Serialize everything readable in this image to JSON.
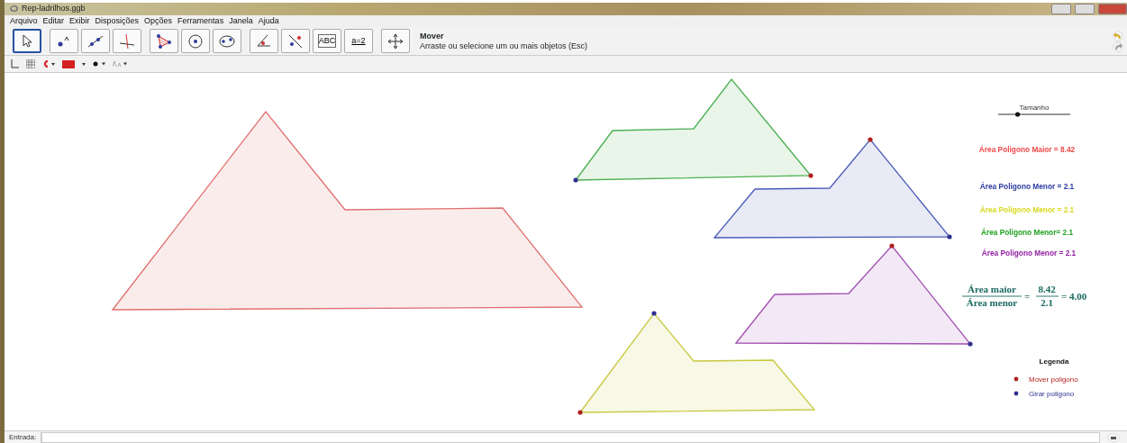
{
  "window": {
    "title": "Rep-ladrilhos.ggb"
  },
  "menu": [
    "Arquivo",
    "Editar",
    "Exibir",
    "Disposições",
    "Opções",
    "Ferramentas",
    "Janela",
    "Ajuda"
  ],
  "tools": [
    {
      "kind": "pointer",
      "selected": true
    },
    {
      "kind": "point",
      "selected": false
    },
    {
      "kind": "line",
      "selected": false
    },
    {
      "kind": "perpendicular",
      "selected": false
    },
    {
      "kind": "polygon",
      "selected": false
    },
    {
      "kind": "circle",
      "selected": false
    },
    {
      "kind": "ellipse",
      "selected": false
    },
    {
      "kind": "angle",
      "selected": false
    },
    {
      "kind": "reflect",
      "selected": false
    },
    {
      "kind": "text",
      "label": "ABC",
      "selected": false
    },
    {
      "kind": "slider",
      "label": "a=2",
      "selected": false
    },
    {
      "kind": "move",
      "selected": false
    }
  ],
  "tool_help": {
    "name": "Mover",
    "hint": "Arraste ou selecione um ou mais objetos (Esc)"
  },
  "style_bar": {
    "color": "#d42020"
  },
  "polygons": [
    {
      "color": "#e07070"
    },
    {
      "color": "#4caf50"
    },
    {
      "color": "#4a5ab8"
    },
    {
      "color": "#a050b0"
    },
    {
      "color": "#c8c840"
    }
  ],
  "slider": {
    "label": "Tamanho",
    "level": 0.27
  },
  "area_labels": [
    {
      "text": "Área Poligono Maior = 8.42",
      "color": "#f04a4a"
    },
    {
      "text": "Área Poligono Menor = 2.1",
      "color": "#2a3aa0"
    },
    {
      "text": "Área Poligono Menor = 2.1",
      "color": "#d8d820"
    },
    {
      "text": "Área Poligono Menor= 2.1",
      "color": "#20a020"
    },
    {
      "text": "Área Poligono Menor = 2.1",
      "color": "#9020a0"
    }
  ],
  "ratio": {
    "num1": "Área maior",
    "den1": "Área menor",
    "equals": "=",
    "num2": "8.42",
    "den2": "2.1",
    "result": "= 4.00"
  },
  "legend": {
    "title": "Legenda",
    "items": [
      {
        "text": "Mover poligono",
        "color": "#b02020"
      },
      {
        "text": "Girar poligono",
        "color": "#303090"
      }
    ]
  },
  "input_bar": {
    "label": "Entrada:"
  }
}
